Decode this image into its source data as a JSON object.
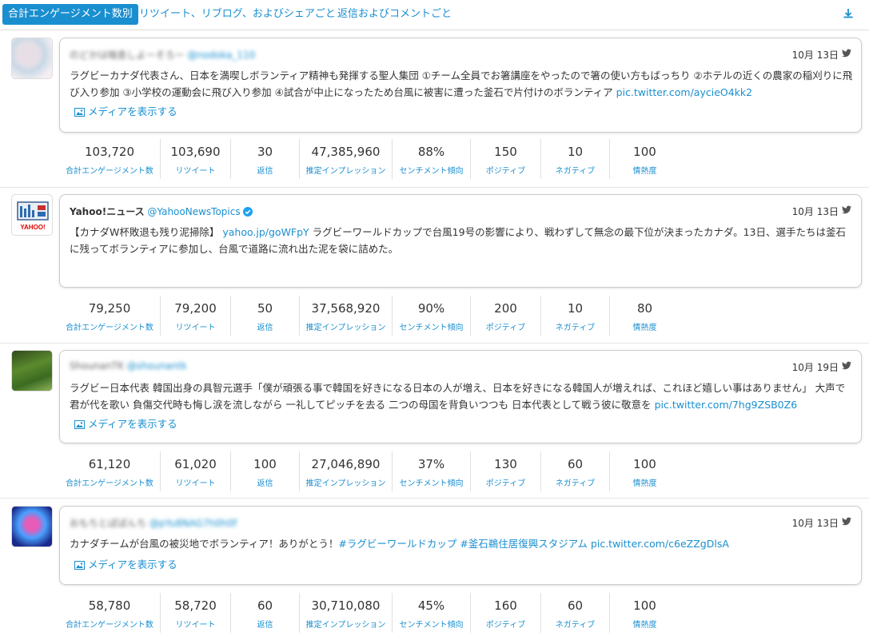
{
  "tabs": [
    {
      "label": "合計エンゲージメント数別"
    },
    {
      "label": "リツイート、リブログ、およびシェアごと"
    },
    {
      "label": "返信およびコメントごと"
    }
  ],
  "stat_labels": [
    "合計エンゲージメント数",
    "リツイート",
    "返信",
    "推定インプレッション",
    "センチメント傾向",
    "ポジティブ",
    "ネガティブ",
    "情熱度"
  ],
  "media_label": "メディアを表示する",
  "posts": [
    {
      "author": "のどかは喘息しよーそろー",
      "handle": "@nodoka_110",
      "date": "10月 13日",
      "text": "ラグビーカナダ代表さん、日本を満喫しボランティア精神も発揮する聖人集団 ①チーム全員でお箸講座をやったので箸の使い方もばっちり ②ホテルの近くの農家の稲刈りに飛び入り参加 ③小学校の運動会に飛び入り参加 ④試合が中止になったため台風に被害に遭った釜石で片付けのボランティア ",
      "link": "pic.twitter.com/aycieO4kk2",
      "stats": [
        "103,720",
        "103,690",
        "30",
        "47,385,960",
        "88%",
        "150",
        "10",
        "100"
      ]
    },
    {
      "author": "Yahoo!ニュース",
      "handle": "@YahooNewsTopics",
      "avatar_text": "YAHOO!",
      "date": "10月 13日",
      "text_pre": "【カナダW杯敗退も残り泥掃除】 ",
      "link": "yahoo.jp/goWFpY",
      "text": " ラグビーワールドカップで台風19号の影響により、戦わずして無念の最下位が決まったカナダ。13日、選手たちは釜石に残ってボランティアに参加し、台風で道路に流れ出た泥を袋に詰めた。",
      "stats": [
        "79,250",
        "79,200",
        "50",
        "37,568,920",
        "90%",
        "200",
        "10",
        "80"
      ]
    },
    {
      "author": "ShounanTK",
      "handle": "@shounantk",
      "date": "10月 19日",
      "text": "ラグビー日本代表 韓国出身の具智元選手「僕が頑張る事で韓国を好きになる日本の人が増え、日本を好きになる韓国人が増えれば、これほど嬉しい事はありません」 大声で君が代を歌い 負傷交代時も悔し涙を流しながら 一礼してピッチを去る 二つの母国を背負いつつも 日本代表として戦う彼に敬意を ",
      "link": "pic.twitter.com/7hg9ZSB0Z6",
      "stats": [
        "61,120",
        "61,020",
        "100",
        "27,046,890",
        "37%",
        "130",
        "60",
        "100"
      ]
    },
    {
      "author": "おもちとぽぽんち",
      "handle": "@pYu8NAG7h0h0f",
      "date": "10月 13日",
      "text": "カナダチームが台風の被災地でボランティア！ありがとう！",
      "hashtags": "#ラグビーワールドカップ #釜石鵜住居復興スタジアム",
      "link": "pic.twitter.com/c6eZZgDlsA",
      "stats": [
        "58,780",
        "58,720",
        "60",
        "30,710,080",
        "45%",
        "160",
        "60",
        "100"
      ]
    }
  ],
  "colors": {
    "accent": "#1a8fd0",
    "border": "#cccccc"
  },
  "icons": [
    "download-icon",
    "twitter-bird-icon",
    "image-icon",
    "verified-badge-icon"
  ]
}
